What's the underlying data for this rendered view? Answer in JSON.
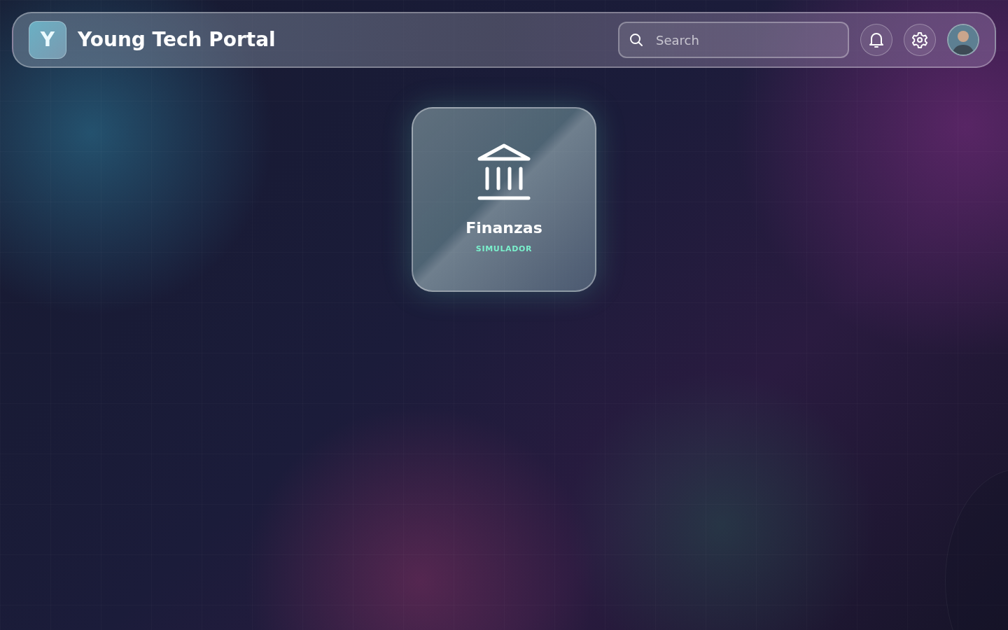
{
  "header": {
    "logo_letter": "Y",
    "title": "Young Tech Portal"
  },
  "search": {
    "placeholder": "Search"
  },
  "apps": [
    {
      "title": "Finanzas",
      "subtitle": "SIMULADOR"
    }
  ]
}
